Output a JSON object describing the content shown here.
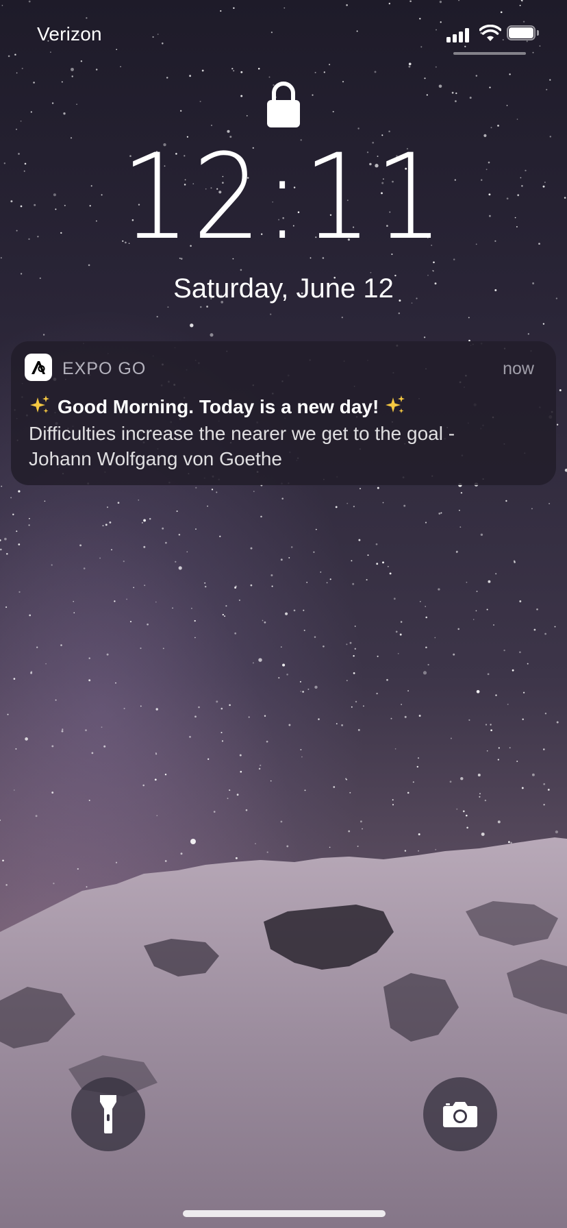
{
  "status_bar": {
    "carrier": "Verizon",
    "icons": [
      "cellular-signal-icon",
      "wifi-icon",
      "battery-icon"
    ]
  },
  "lock_screen": {
    "lock_icon": "lock-icon",
    "time": "12:11",
    "date": "Saturday, June 12"
  },
  "notification": {
    "app_icon": "expo-go-app-icon",
    "app_name": "EXPO GO",
    "time": "now",
    "title": "Good Morning. Today is a new day!",
    "title_emoji": "sparkles",
    "body_line1": "Difficulties increase the nearer we get to the goal -",
    "body_line2": "Johann Wolfgang von Goethe"
  },
  "quick_actions": {
    "left": "flashlight-icon",
    "right": "camera-icon"
  },
  "colors": {
    "notification_background": "#221d2a",
    "sparkle": "#f5c842"
  }
}
